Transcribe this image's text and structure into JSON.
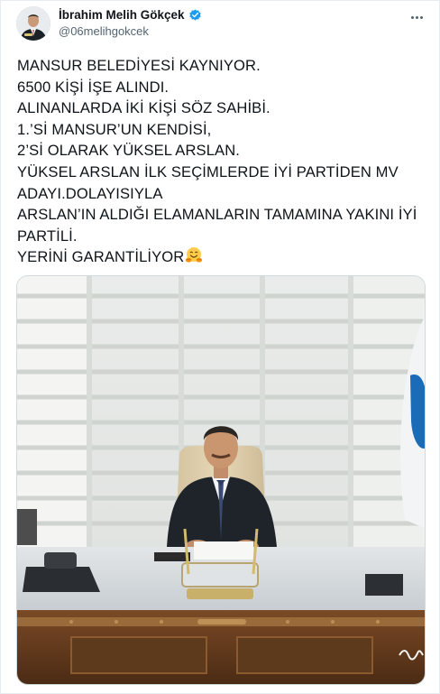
{
  "tweet": {
    "author": {
      "display_name": "İbrahim Melih Gökçek",
      "handle": "@06melihgokcek",
      "verified": true,
      "avatar_icon": "profile-photo"
    },
    "more_icon": "more-horizontal-icon",
    "text": "MANSUR BELEDİYESİ KAYNIYOR.\n6500 KİŞİ İŞE ALINDI.\nALINANLARDA İKİ KİŞİ SÖZ SAHİBİ.\n1.’Sİ MANSUR’UN KENDİSİ,\n2’Sİ OLARAK YÜKSEL ARSLAN.\nYÜKSEL ARSLAN İLK SEÇİMLERDE İYİ PARTİDEN MV ADAYI.DOLAYISIYLA\nARSLAN’IN ALDIĞI ELAMANLARIN TAMAMINA YAKINI İYİ PARTİLİ.\nYERİNİ GARANTİLİYOR",
    "text_emoji": "hugging-face-emoji",
    "media": {
      "type": "photo",
      "subject": "man-seated-at-office-desk"
    }
  },
  "colors": {
    "text_primary": "#0f1419",
    "text_secondary": "#536471",
    "verified_blue": "#1d9bf0",
    "border": "#cfd9de"
  }
}
